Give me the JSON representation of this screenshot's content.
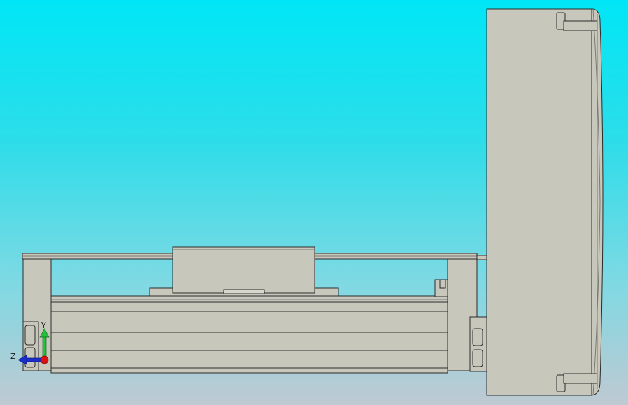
{
  "viewport": {
    "view": "cad-3d-model-viewport",
    "background_top": "#00e6f6",
    "background_bottom": "#bfc9d2",
    "model_fill": "#c8c7bc",
    "model_edge": "#2b2b2b"
  },
  "triad": {
    "y_label": "Y",
    "z_label": "Z",
    "y_color": "#22c33a",
    "z_color": "#1a2ed0",
    "origin_color": "#e01010"
  }
}
